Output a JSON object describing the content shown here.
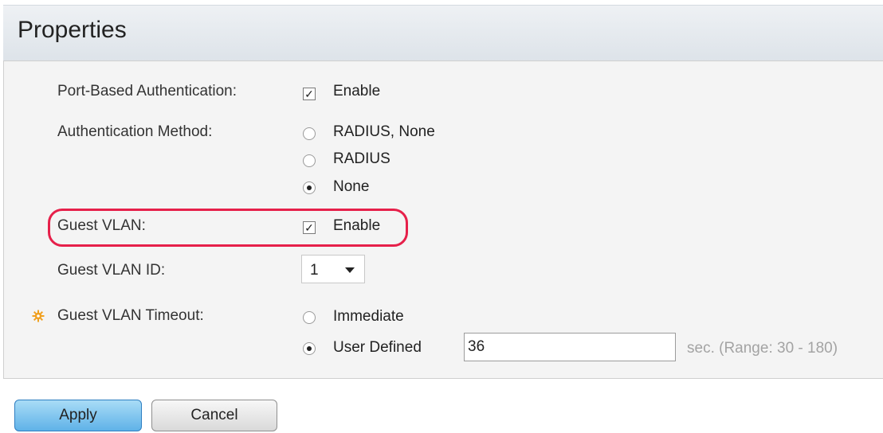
{
  "header": {
    "title": "Properties"
  },
  "form": {
    "port_auth": {
      "label": "Port-Based Authentication:",
      "checkbox_label": "Enable",
      "checked": true
    },
    "auth_method": {
      "label": "Authentication Method:",
      "options": [
        "RADIUS, None",
        "RADIUS",
        "None"
      ],
      "selected": "None"
    },
    "guest_vlan": {
      "label": "Guest VLAN:",
      "checkbox_label": "Enable",
      "checked": true
    },
    "guest_vlan_id": {
      "label": "Guest VLAN ID:",
      "value": "1"
    },
    "guest_vlan_timeout": {
      "label": "Guest VLAN Timeout:",
      "options": [
        "Immediate",
        "User Defined"
      ],
      "selected": "User Defined",
      "value": "36",
      "range_hint": "sec. (Range: 30 - 180)"
    }
  },
  "buttons": {
    "apply": "Apply",
    "cancel": "Cancel"
  },
  "icons": {
    "required": "gear-icon"
  },
  "colors": {
    "highlight": "#e6204a",
    "apply_button": "#5fb2e8"
  }
}
